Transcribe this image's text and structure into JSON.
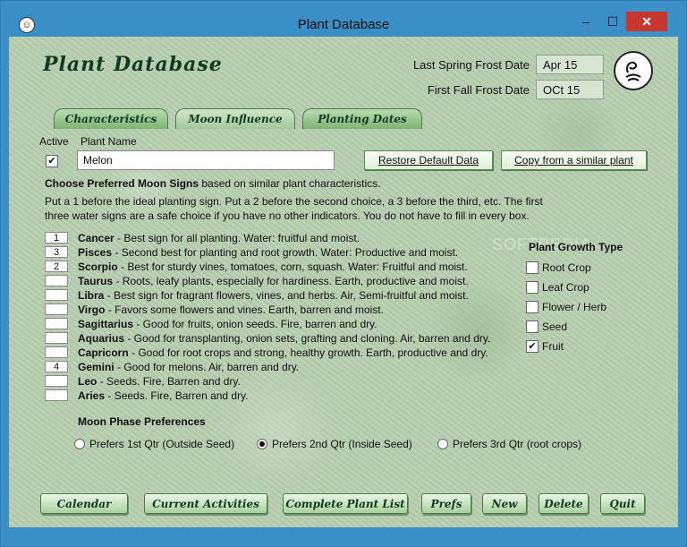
{
  "window": {
    "title": "Plant Database",
    "minimize_label": "–",
    "maximize_label": "☐",
    "close_label": "✕"
  },
  "app": {
    "heading": "Plant Database",
    "last_spring_frost_label": "Last Spring Frost Date",
    "last_spring_frost_value": "Apr 15",
    "first_fall_frost_label": "First Fall Frost Date",
    "first_fall_frost_value": "OCt 15"
  },
  "tabs": [
    {
      "label": "Characteristics"
    },
    {
      "label": "Moon Influence"
    },
    {
      "label": "Planting Dates"
    }
  ],
  "plant": {
    "active_label": "Active",
    "active_checked": "✔",
    "name_label": "Plant Name",
    "name_value": "Melon",
    "restore_button": "Restore Default Data",
    "copy_button": "Copy from a similar plant"
  },
  "moon_signs": {
    "intro_bold": "Choose Preferred Moon Signs",
    "intro_rest": " based on similar plant characteristics.",
    "instructions_line1": "Put a 1 before the ideal planting sign. Put a 2 before the second choice, a 3 before the third, etc. The first",
    "instructions_line2": "three water signs are a safe choice if you have no other indicators. You do not have to fill in every box.",
    "signs": [
      {
        "value": "1",
        "name": "Cancer",
        "desc": " - Best sign for all planting. Water: fruitful and moist."
      },
      {
        "value": "3",
        "name": "Pisces",
        "desc": " - Second best for planting and root growth. Water: Productive and moist."
      },
      {
        "value": "2",
        "name": "Scorpio",
        "desc": " - Best for sturdy vines, tomatoes, corn, squash. Water: Fruitful and moist."
      },
      {
        "value": "",
        "name": "Taurus",
        "desc": " - Roots, leafy plants, especially for hardiness. Earth, productive and moist."
      },
      {
        "value": "",
        "name": "Libra",
        "desc": " - Best sign for fragrant flowers, vines, and herbs. Air, Semi-fruitful and moist."
      },
      {
        "value": "",
        "name": "Virgo",
        "desc": " - Favors some flowers and vines. Earth, barren and moist."
      },
      {
        "value": "",
        "name": "Sagittarius",
        "desc": " - Good for fruits, onion seeds. Fire, barren and dry."
      },
      {
        "value": "",
        "name": "Aquarius",
        "desc": " - Good for transplanting, onion sets, grafting and cloning. Air, barren and dry."
      },
      {
        "value": "",
        "name": "Capricorn",
        "desc": " - Good for root crops and strong, healthy growth. Earth, productive and dry."
      },
      {
        "value": "4",
        "name": "Gemini",
        "desc": " - Good for melons. Air, barren and dry."
      },
      {
        "value": "",
        "name": "Leo",
        "desc": " - Seeds. Fire, Barren and dry."
      },
      {
        "value": "",
        "name": "Aries",
        "desc": " - Seeds. Fire, Barren and dry."
      }
    ]
  },
  "growth_type": {
    "title": "Plant Growth Type",
    "items": [
      {
        "label": "Root Crop",
        "checked": ""
      },
      {
        "label": "Leaf Crop",
        "checked": ""
      },
      {
        "label": "Flower / Herb",
        "checked": ""
      },
      {
        "label": "Seed",
        "checked": ""
      },
      {
        "label": "Fruit",
        "checked": "✔"
      }
    ]
  },
  "moon_phase": {
    "title": "Moon Phase Preferences",
    "options": [
      {
        "label": "Prefers 1st Qtr (Outside Seed)",
        "selected": false
      },
      {
        "label": "Prefers 2nd Qtr (Inside Seed)",
        "selected": true
      },
      {
        "label": "Prefers 3rd Qtr (root crops)",
        "selected": false
      }
    ]
  },
  "watermark": "SOFTPEDIA",
  "bottom_buttons": {
    "calendar": "Calendar",
    "current_activities": "Current Activities",
    "complete_plant_list": "Complete Plant List",
    "prefs": "Prefs",
    "new": "New",
    "delete": "Delete",
    "quit": "Quit"
  }
}
